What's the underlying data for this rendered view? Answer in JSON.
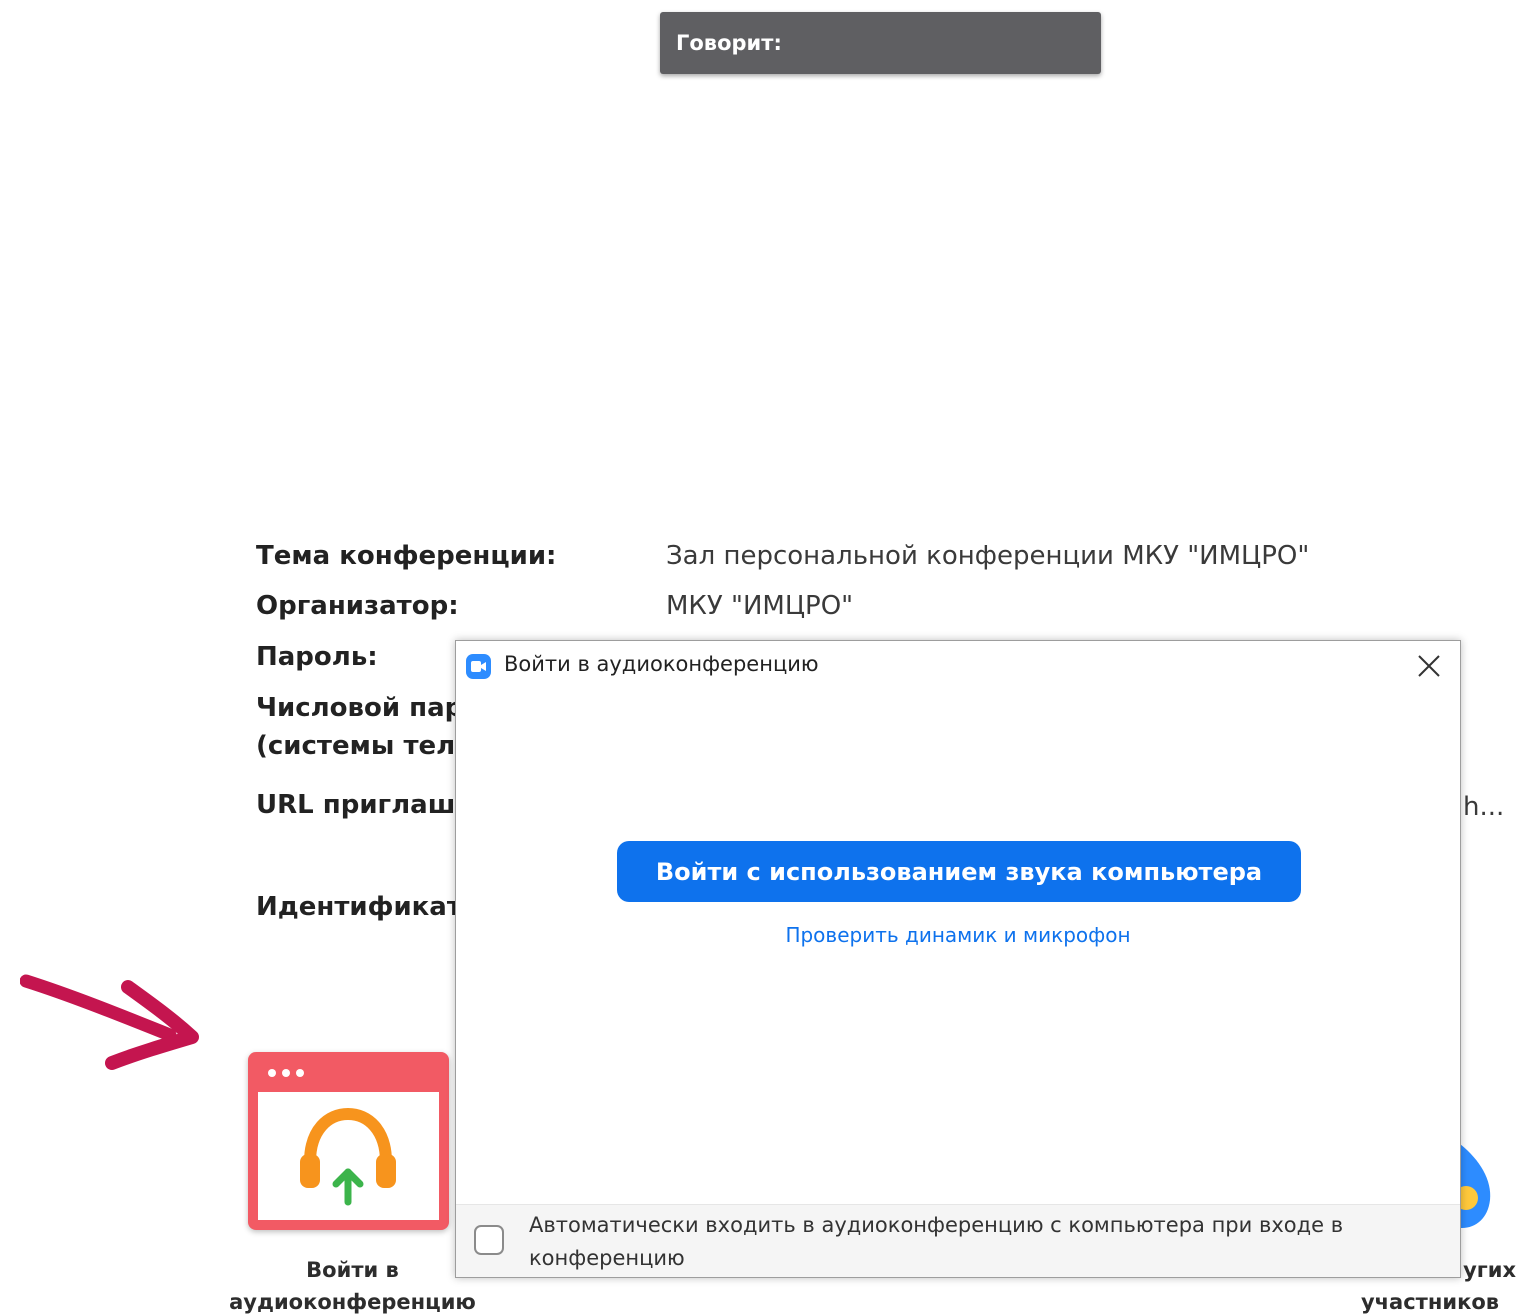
{
  "speaker_banner": {
    "label": "Говорит:"
  },
  "meeting_info": {
    "topic_label": "Тема конференции:",
    "topic_value": "Зал персональной конференции МКУ \"ИМЦРО\"",
    "host_label": "Организатор:",
    "host_value": "МКУ \"ИМЦРО\"",
    "password_label": "Пароль:",
    "numeric_password_label_1": "Числовой пар",
    "numeric_password_label_2": "(системы теле",
    "invite_url_label": "URL приглаше",
    "invite_url_tail": "h...",
    "meeting_id_label": "Идентификато"
  },
  "tiles": {
    "join_audio_caption_1": "Войти в",
    "join_audio_caption_2": "аудиоконференцию",
    "invite_caption_1": "угих",
    "invite_caption_2": "участников"
  },
  "dialog": {
    "title": "Войти в аудиоконференцию",
    "join_button_label": "Войти с использованием звука компьютера",
    "test_link": "Проверить динамик и микрофон",
    "auto_join_label": "Автоматически входить в аудиоконференцию с компьютера при входе в конференцию",
    "auto_join_checked": false
  },
  "colors": {
    "accent": "#0e72ed",
    "banner": "#5f5f62",
    "tile_red": "#f25a64",
    "arrow": "#c4154f"
  }
}
